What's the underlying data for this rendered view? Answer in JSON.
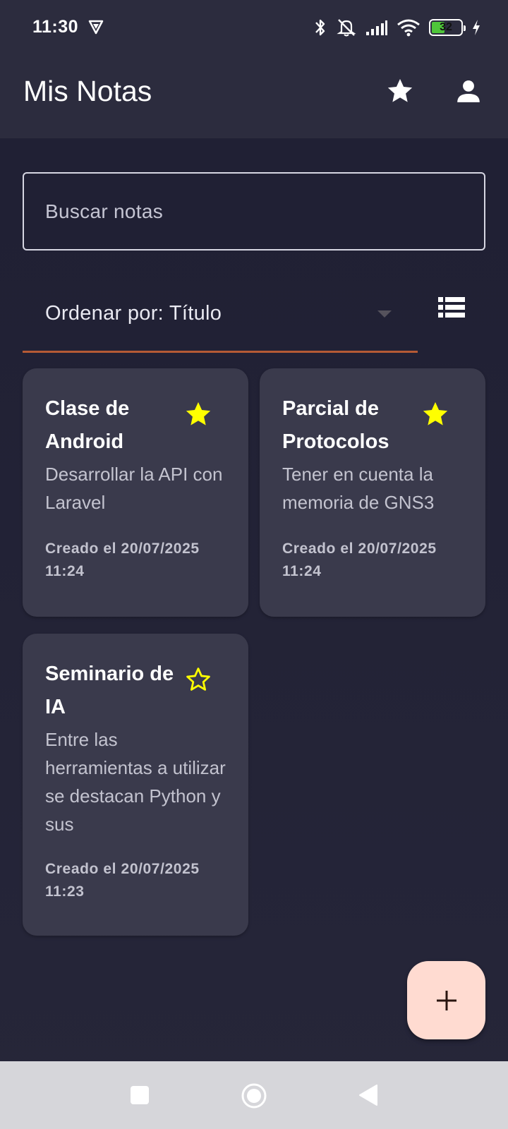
{
  "status_bar": {
    "time": "11:30",
    "battery_level": "32",
    "icons": [
      "vpn-icon",
      "bluetooth-icon",
      "silent-bell-icon",
      "signal-icon",
      "wifi-icon",
      "battery-icon",
      "charging-icon"
    ]
  },
  "app_bar": {
    "title": "Mis Notas",
    "actions": [
      "star-icon",
      "profile-icon"
    ]
  },
  "search": {
    "placeholder": "Buscar notas",
    "value": ""
  },
  "sort": {
    "label": "Ordenar por: Título"
  },
  "notes": [
    {
      "title": "Clase de Android",
      "body": "Desarrollar la API con Laravel",
      "date": "Creado el 20/07/2025 11:24",
      "favorite": true
    },
    {
      "title": "Parcial de Protocolos",
      "body": "Tener en cuenta la memoria de GNS3",
      "date": "Creado el 20/07/2025 11:24",
      "favorite": true
    },
    {
      "title": "Seminario de IA",
      "body": "Entre las herramientas a utilizar se destacan Python y sus",
      "date": "Creado el 20/07/2025 11:23",
      "favorite": false
    }
  ],
  "colors": {
    "background": "#22223a",
    "app_bar": "#2c2c3e",
    "card": "#3a3a4c",
    "accent_underline": "#b55a35",
    "star": "#ffff00",
    "fab": "#ffdbd1"
  }
}
